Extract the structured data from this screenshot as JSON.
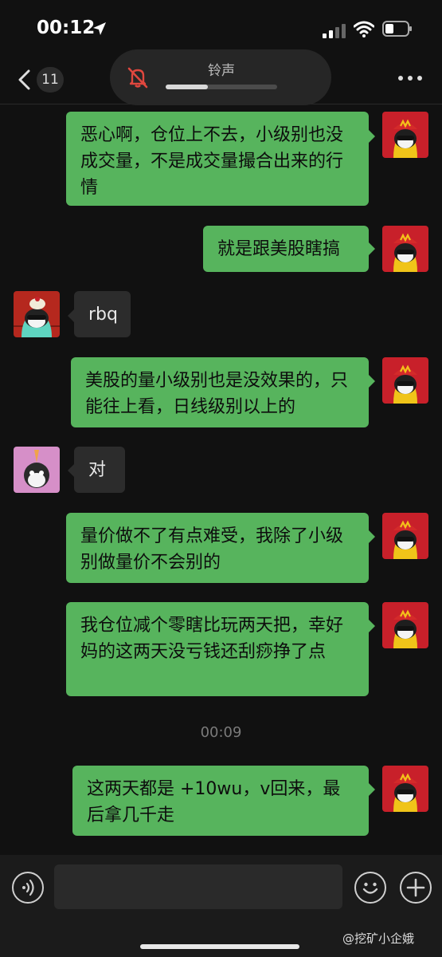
{
  "status_bar": {
    "time": "00:12"
  },
  "nav": {
    "unread_count": "11",
    "ringer_label": "铃声",
    "ringer_volume": 0.38
  },
  "messages": [
    {
      "side": "me",
      "text": "恶心啊，仓位上不去，小级别也没成交量，不是成交量撮合出来的行情"
    },
    {
      "side": "me",
      "text": "就是跟美股瞎搞"
    },
    {
      "side": "them",
      "text": "rbq"
    },
    {
      "side": "me",
      "text": "美股的量小级别也是没效果的，只能往上看，日线级别以上的"
    },
    {
      "side": "them",
      "text": "对"
    },
    {
      "side": "me",
      "text": "量价做不了有点难受，我除了小级别做量价不会别的"
    },
    {
      "side": "me",
      "text": "我仓位减个零瞎比玩两天把，幸好妈的这两天没亏钱还刮痧挣了点"
    },
    {
      "side": "me",
      "text": "这两天都是 +10wu，v回来，最后拿几千走"
    }
  ],
  "timestamp": "00:09",
  "input": {
    "placeholder": ""
  },
  "watermark": "@挖矿小企娥",
  "colors": {
    "bubble_me": "#57b45d",
    "bubble_them": "#2c2c2c",
    "background": "#111111"
  },
  "icons": [
    "location-arrow-icon",
    "signal-icon",
    "wifi-icon",
    "battery-icon",
    "back-chevron-icon",
    "bell-muted-icon",
    "more-icon",
    "voice-icon",
    "emoji-icon",
    "plus-icon"
  ]
}
